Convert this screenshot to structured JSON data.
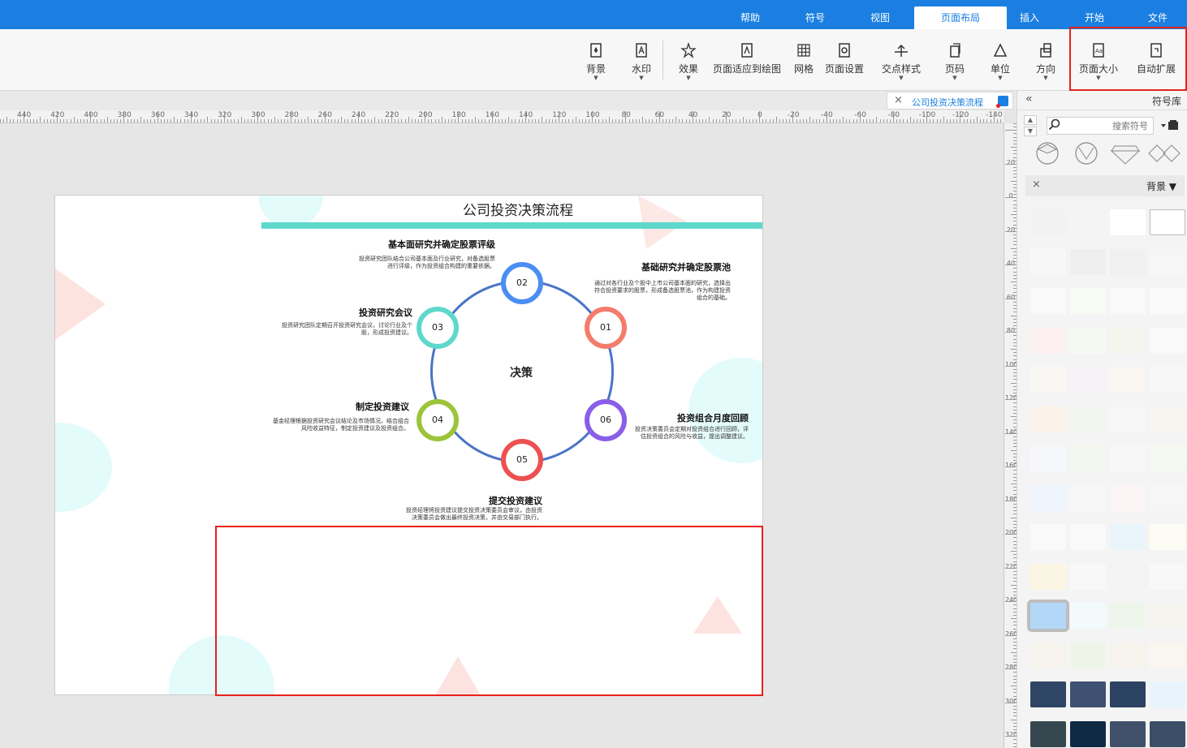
{
  "tabs": [
    {
      "label": "文件",
      "active": false
    },
    {
      "label": "开始",
      "active": false
    },
    {
      "label": "插入",
      "active": false
    },
    {
      "label": "页面布局",
      "active": true
    },
    {
      "label": "视图",
      "active": false
    },
    {
      "label": "符号",
      "active": false
    },
    {
      "label": "帮助",
      "active": false
    }
  ],
  "ribbon": {
    "auto_expand": "自动扩展",
    "page_size": "页面大小",
    "orientation": "方向",
    "unit": "单位",
    "page_number": "页码",
    "cross_style": "交点样式",
    "page_setup": "页面设置",
    "grid": "网格",
    "fit_to_drawing": "页面适应到绘图",
    "effects": "效果",
    "watermark": "水印",
    "background": "背景"
  },
  "document": {
    "tab_name": "公司投资决策流程"
  },
  "ruler": {
    "h_labels": [
      "-140",
      "-120",
      "-100",
      "-80",
      "-60",
      "-40",
      "-20",
      "0",
      "20",
      "40",
      "60",
      "80",
      "100",
      "120",
      "140",
      "160",
      "180",
      "200",
      "220",
      "240",
      "260",
      "280",
      "300",
      "320",
      "340",
      "360",
      "380",
      "400",
      "420",
      "440"
    ],
    "v_labels": [
      "-20",
      "0",
      "20",
      "40",
      "60",
      "80",
      "100",
      "120",
      "140",
      "160",
      "180",
      "200",
      "220",
      "240",
      "260",
      "280",
      "300",
      "320"
    ]
  },
  "diagram": {
    "title": "公司投资决策流程",
    "center": "决策",
    "nodes": [
      {
        "num": "01",
        "color": "#f47c6c"
      },
      {
        "num": "02",
        "color": "#4a8ef2"
      },
      {
        "num": "03",
        "color": "#5fd8cc"
      },
      {
        "num": "04",
        "color": "#9cc43a"
      },
      {
        "num": "05",
        "color": "#ee5050"
      },
      {
        "num": "06",
        "color": "#8a5ee8"
      }
    ],
    "steps": [
      {
        "title": "基础研究并确定股票池",
        "desc": "通过对各行业及个股中上市公司基本面的研究，选择出符合投资要求的股票，形成备选股票池，作为构建投资组合的基础。"
      },
      {
        "title": "基本面研究并确定股票评级",
        "desc": "投资研究团队结合公司基本面及行业研究，对备选股票进行评级，作为投资组合构建的重要依据。"
      },
      {
        "title": "投资研究会议",
        "desc": "投资研究团队定期召开投资研究会议，讨论行业及个股，形成投资建议。"
      },
      {
        "title": "制定投资建议",
        "desc": "基金经理根据投资研究会议结论及市场情况，结合组合风险收益特征，制定投资建议及投资组合。"
      },
      {
        "title": "提交投资建议",
        "desc": "投资经理将投资建议提交投资决策委员会审议，由投资决策委员会做出最终投资决策，并由交易部门执行。"
      },
      {
        "title": "投资组合月度回顾",
        "desc": "投资决策委员会定期对投资组合进行回顾，评估投资组合的风险与收益，提出调整建议。"
      }
    ]
  },
  "panel": {
    "title": "符号库",
    "search_placeholder": "搜索符号",
    "category": "背景"
  }
}
